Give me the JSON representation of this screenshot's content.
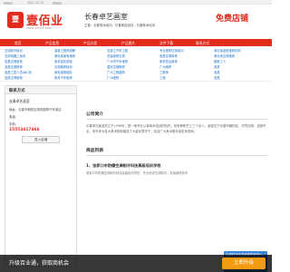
{
  "topbar": {
    "left": "壹佰网",
    "date": "2022-12-01",
    "site": "壹佰网"
  },
  "header": {
    "logo_mark": "壹",
    "logo_text": "壹佰业",
    "logo_url": "www.100ye.com",
    "site_title": "长春卓艺画室",
    "site_desc": "主营：长春美术培训，长春素描培训，长春美术培训",
    "free_shop": "免费店铺"
  },
  "nav": {
    "items": [
      "首页",
      "产品信息",
      "产品分类",
      "产品图片",
      "文件下载",
      "联系方式"
    ]
  },
  "cats": [
    [
      "空调制冷培训",
      "高新工程师招聘",
      "空调工汽车工程",
      "专业维修空调培训",
      "湖北省金税维修技师"
    ],
    [
      "空调电器工培训",
      "湖北省家电维修",
      "安装维修空调",
      "宜昌空调维修",
      "湖北省空调维修"
    ],
    [
      "宜昌空调维修",
      "家具高压调班",
      "广州市汽车维修",
      "家电售后维修",
      "建筑工人"
    ],
    [
      "宜昌空调维修",
      "空调维修培训",
      "重庆空调维修",
      "广州维修",
      "宜昌"
    ],
    [
      "宜昌三层人员ABC班",
      "家电维修团队",
      "广州工程建筑",
      "工程师",
      "宜昌"
    ],
    [
      "宜昌空调维修",
      "家具汽车维修",
      "广州维修",
      "工程",
      "宜昌"
    ]
  ],
  "side": {
    "title": "联系方式",
    "name": "长春卓艺画室",
    "addr_label": "地址",
    "addr": "长春市朝阳区湖西路等汽车城店",
    "tel_label": "电话",
    "phone_label": "手机",
    "phone": "15553417466",
    "entry_btn": "进入店铺"
  },
  "main": {
    "intro_title": "公司简介",
    "intro_text": "长春卓艺画室成立于1998年，是一家专业从事美术培训的机构，现有教职员工三十余人，画室位于长春市朝阳区，环境优雅，设施齐全，多年来为各大美术院校输送了大量优秀学子，欢迎广大美术爱好者前来咨询。",
    "goods_title": "商品列表",
    "goods_name": "1、张家口市防爆空调制冷科技高级培训学校",
    "goods_line": "张家口市防爆空调制冷科技高级培训学校，专业培训空调制冷，安装维修技术",
    "thumb_text": "空调制冷安装维修精品班火热招生中"
  },
  "bottom": {
    "text": "升级百业通，获取商机会",
    "btn": "立即升级"
  }
}
